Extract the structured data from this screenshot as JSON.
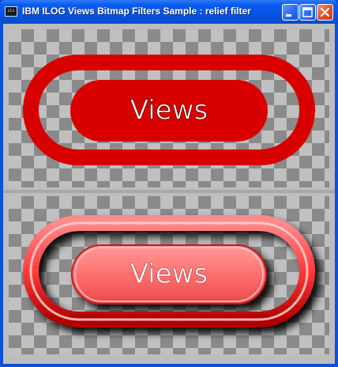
{
  "window": {
    "title": "IBM ILOG Views Bitmap Filters Sample : relief filter",
    "app_icon_text": "ilv"
  },
  "panels": {
    "top": {
      "label": "Views",
      "filter": "none"
    },
    "bottom": {
      "label": "Views",
      "filter": "relief"
    }
  },
  "colors": {
    "shape_red": "#d90000",
    "relief_red": "#ff6f6f",
    "titlebar_blue": "#0753e4"
  }
}
